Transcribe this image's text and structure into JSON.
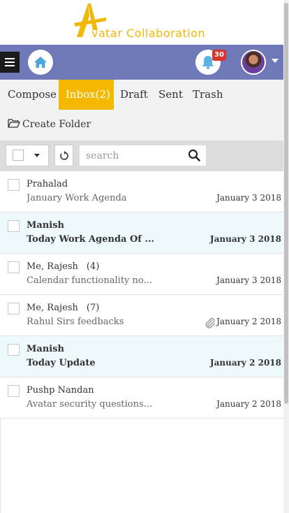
{
  "brand": {
    "logo_text": "vatar Collaboration",
    "logo_mark": "avatar-logo-a",
    "primary_color": "#6f79b8",
    "accent_color": "#f5b800"
  },
  "navbar": {
    "menu_icon": "hamburger-icon",
    "home_icon": "home-icon",
    "notifications_icon": "bell-icon",
    "notifications_count": "30",
    "profile_icon": "avatar"
  },
  "tabs": [
    {
      "label": "Compose",
      "active": false
    },
    {
      "label": "Inbox(2)",
      "active": true
    },
    {
      "label": "Draft",
      "active": false
    },
    {
      "label": "Sent",
      "active": false
    },
    {
      "label": "Trash",
      "active": false
    }
  ],
  "create_folder": {
    "label": "Create Folder",
    "icon": "folder-open-icon"
  },
  "toolbar": {
    "select_all_icon": "checkbox",
    "refresh_icon": "refresh-icon",
    "search_placeholder": "search",
    "search_icon": "search-icon"
  },
  "messages": [
    {
      "sender": "Prahalad",
      "count": "",
      "subject": "January Work Agenda",
      "date": "January 3 2018",
      "unread": false,
      "attachment": false
    },
    {
      "sender": "Manish",
      "count": "",
      "subject": "Today Work Agenda Of ...",
      "date": "January 3 2018",
      "unread": true,
      "attachment": false
    },
    {
      "sender": "Me, Rajesh",
      "count": "(4)",
      "subject": "Calendar functionality no...",
      "date": "January 3 2018",
      "unread": false,
      "attachment": false
    },
    {
      "sender": "Me, Rajesh",
      "count": "(7)",
      "subject": "Rahul Sirs feedbacks",
      "date": "January 2 2018",
      "unread": false,
      "attachment": true
    },
    {
      "sender": "Manish",
      "count": "",
      "subject": "Today Update",
      "date": "January 2 2018",
      "unread": true,
      "attachment": false
    },
    {
      "sender": "Pushp Nandan",
      "count": "",
      "subject": "Avatar security questions...",
      "date": "January 2 2018",
      "unread": false,
      "attachment": false
    }
  ]
}
